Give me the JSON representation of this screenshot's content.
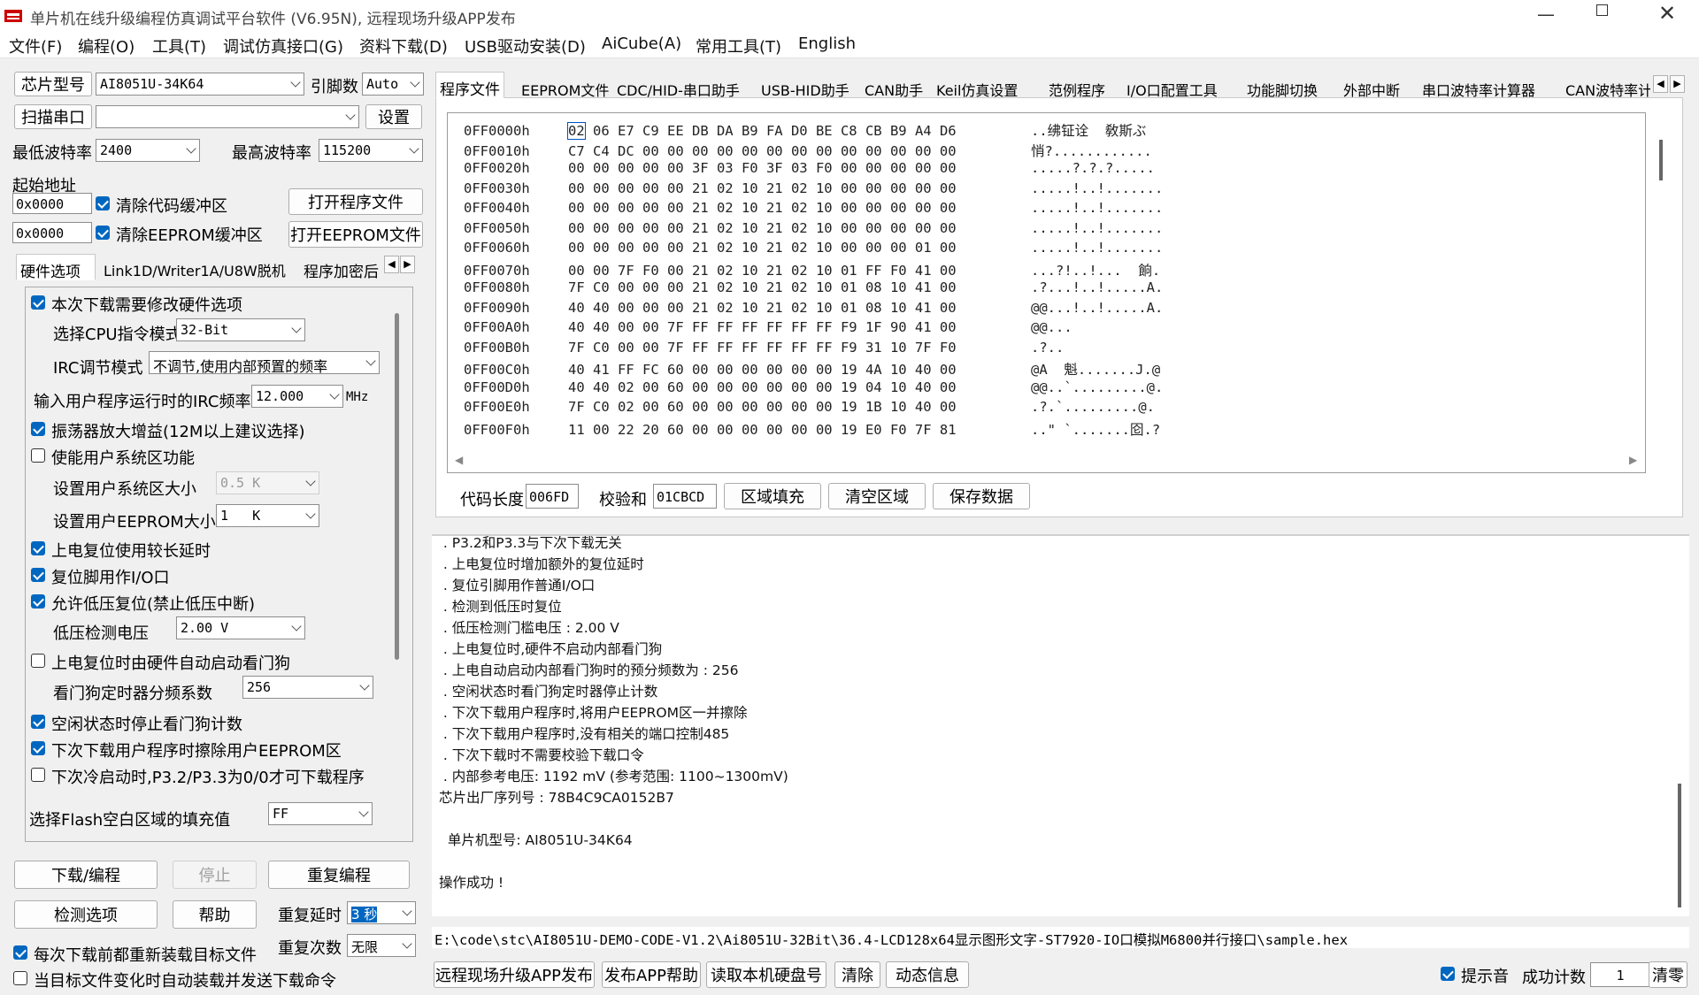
{
  "window": {
    "title": "单片机在线升级编程仿真调试平台软件 (V6.95N), 远程现场升级APP发布"
  },
  "menu": [
    "文件(F)",
    "编程(O)",
    "工具(T)",
    "调试仿真接口(G)",
    "资料下载(D)",
    "USB驱动安装(D)",
    "AiCube(A)",
    "常用工具(T)",
    "English"
  ],
  "left": {
    "chip_label": "芯片型号",
    "chip_value": "AI8051U-34K64",
    "pins_label": "引脚数",
    "pins_value": "Auto",
    "scan_label": "扫描串口",
    "port_value": "",
    "settings_label": "设置",
    "min_baud_label": "最低波特率",
    "min_baud_value": "2400",
    "max_baud_label": "最高波特率",
    "max_baud_value": "115200",
    "start_addr_label": "起始地址",
    "addr1": "0x0000",
    "clear_code": "清除代码缓冲区",
    "open_prog": "打开程序文件",
    "addr2": "0x0000",
    "clear_eeprom": "清除EEPROM缓冲区",
    "open_eeprom": "打开EEPROM文件",
    "tabs": [
      "硬件选项",
      "Link1D/Writer1A/U8W脱机",
      "程序加密后"
    ],
    "hw": {
      "modify": "本次下载需要修改硬件选项",
      "cpu_label": "选择CPU指令模式",
      "cpu_value": "32-Bit",
      "irc_label": "IRC调节模式",
      "irc_value": "不调节,使用内部预置的频率",
      "freq_label": "输入用户程序运行时的IRC频率",
      "freq_value": "12.000",
      "freq_unit": "MHz",
      "osc": "振荡器放大增益(12M以上建议选择)",
      "sysarea": "使能用户系统区功能",
      "sys_size_label": "设置用户系统区大小",
      "sys_size_value": "0.5 K",
      "eeprom_size_label": "设置用户EEPROM大小",
      "eeprom_size_value": "1   K",
      "long_delay": "上电复位使用较长延时",
      "reset_io": "复位脚用作I/O口",
      "lvr": "允许低压复位(禁止低压中断)",
      "lv_label": "低压检测电压",
      "lv_value": "2.00 V",
      "wdt_auto": "上电复位时由硬件自动启动看门狗",
      "wdt_div_label": "看门狗定时器分频系数",
      "wdt_div_value": "256",
      "idle_wdt": "空闲状态时停止看门狗计数",
      "erase_eeprom": "下次下载用户程序时擦除用户EEPROM区",
      "p32": "下次冷启动时,P3.2/P3.3为0/0才可下载程序",
      "fill_label": "选择Flash空白区域的填充值",
      "fill_value": "FF"
    },
    "download": "下载/编程",
    "stop": "停止",
    "reprogram": "重复编程",
    "check": "检测选项",
    "help": "帮助",
    "delay_label": "重复延时",
    "delay_value": "3 秒",
    "count_label": "重复次数",
    "count_value": "无限",
    "reload": "每次下载前都重新装载目标文件",
    "autosend": "当目标文件变化时自动装载并发送下载命令"
  },
  "right": {
    "tabs": [
      "程序文件",
      "EEPROM文件",
      "CDC/HID-串口助手",
      "USB-HID助手",
      "CAN助手",
      "Keil仿真设置",
      "范例程序",
      "I/O口配置工具",
      "功能脚切换",
      "外部中断",
      "串口波特率计算器",
      "CAN波特率计"
    ],
    "hex_rows": [
      [
        "0FF0000h",
        "02 06 E7 C9 EE DB DA B9 FA D0 BE C8 CB B9 A4 D6",
        "..绋钲诠  敎斯ぶ"
      ],
      [
        "0FF0010h",
        "C7 C4 DC 00 00 00 00 00 00 00 00 00 00 00 00 00",
        "悄?............"
      ],
      [
        "0FF0020h",
        "00 00 00 00 00 3F 03 F0 3F 03 F0 00 00 00 00 00",
        ".....?.?.?....."
      ],
      [
        "0FF0030h",
        "00 00 00 00 00 21 02 10 21 02 10 00 00 00 00 00",
        ".....!..!......."
      ],
      [
        "0FF0040h",
        "00 00 00 00 00 21 02 10 21 02 10 00 00 00 00 00",
        ".....!..!......."
      ],
      [
        "0FF0050h",
        "00 00 00 00 00 21 02 10 21 02 10 00 00 00 00 00",
        ".....!..!......."
      ],
      [
        "0FF0060h",
        "00 00 00 00 00 21 02 10 21 02 10 00 00 00 01 00",
        ".....!..!......."
      ],
      [
        "0FF0070h",
        "00 00 7F F0 00 21 02 10 21 02 10 01 FF F0 41 00",
        "...?!..!...  餉."
      ],
      [
        "0FF0080h",
        "7F C0 00 00 00 21 02 10 21 02 10 01 08 10 41 00",
        ".?...!..!.....A."
      ],
      [
        "0FF0090h",
        "40 40 00 00 00 21 02 10 21 02 10 01 08 10 41 00",
        "@@...!..!.....A."
      ],
      [
        "0FF00A0h",
        "40 40 00 00 7F FF FF FF FF FF FF F9 1F 90 41 00",
        "@@..."
      ],
      [
        "0FF00B0h",
        "7F C0 00 00 7F FF FF FF FF FF FF F9 31 10 7F F0",
        ".?.."
      ],
      [
        "0FF00C0h",
        "40 41 FF FC 60 00 00 00 00 00 00 19 4A 10 40 00",
        "@A  魁.......J.@"
      ],
      [
        "0FF00D0h",
        "40 40 02 00 60 00 00 00 00 00 00 19 04 10 40 00",
        "@@..`.........@."
      ],
      [
        "0FF00E0h",
        "7F C0 02 00 60 00 00 00 00 00 00 19 1B 10 40 00",
        ".?.`.........@."
      ],
      [
        "0FF00F0h",
        "11 00 22 20 60 00 00 00 00 00 00 19 E0 F0 7F 81",
        "..\" `.......囵.?"
      ]
    ],
    "code_len_label": "代码长度",
    "code_len": "006FD",
    "checksum_label": "校验和",
    "checksum": "01CBCD",
    "fill_btn": "区域填充",
    "clear_btn": "清空区域",
    "save_btn": "保存数据",
    "log": [
      " . P3.2和P3.3与下次下载无关",
      " . 上电复位时增加额外的复位延时",
      " . 复位引脚用作普通I/O口",
      " . 检测到低压时复位",
      " . 低压检测门槛电压 : 2.00 V",
      " . 上电复位时,硬件不启动内部看门狗",
      " . 上电自动启动内部看门狗时的预分频数为 : 256",
      " . 空闲状态时看门狗定时器停止计数",
      " . 下次下载用户程序时,将用户EEPROM区一并擦除",
      " . 下次下载用户程序时,没有相关的端口控制485",
      " . 下次下载时不需要校验下载口令",
      " . 内部参考电压: 1192 mV (参考范围: 1100~1300mV)",
      "芯片出厂序列号 : 78B4C9CA0152B7",
      "",
      "  单片机型号: AI8051U-34K64",
      "",
      "操作成功 !"
    ],
    "path": "E:\\code\\stc\\AI8051U-DEMO-CODE-V1.2\\Ai8051U-32Bit\\36.4-LCD128x64显示图形文字-ST7920-IO口模拟M6800并行接口\\sample.hex",
    "app_publish": "远程现场升级APP发布",
    "app_help": "发布APP帮助",
    "read_disk": "读取本机硬盘号",
    "clear": "清除",
    "dynamic": "动态信息",
    "beep": "提示音",
    "success_label": "成功计数",
    "success_value": "1",
    "reset_count": "清零"
  }
}
